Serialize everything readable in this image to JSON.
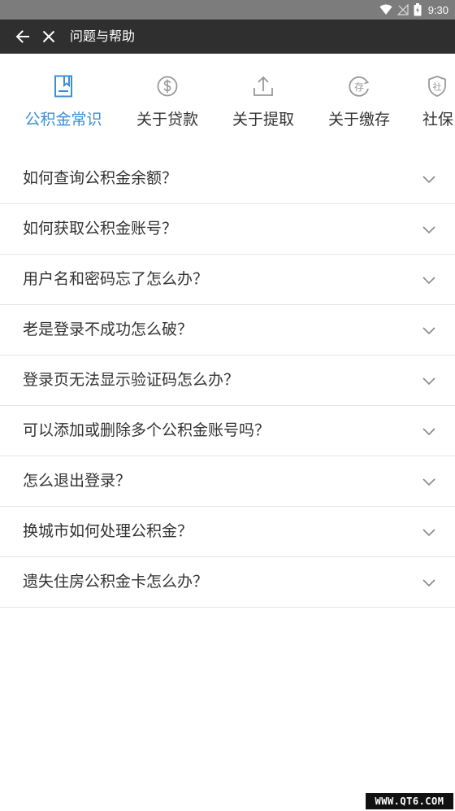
{
  "status_bar": {
    "time": "9:30",
    "icons": [
      "wifi-icon",
      "signal-icon",
      "battery-icon"
    ]
  },
  "app_bar": {
    "title": "问题与帮助",
    "back_icon": "arrow-left-icon",
    "close_icon": "close-icon"
  },
  "tabs": [
    {
      "label": "公积金常识",
      "icon": "document-icon",
      "active": true
    },
    {
      "label": "关于贷款",
      "icon": "dollar-circle-icon",
      "active": false
    },
    {
      "label": "关于提取",
      "icon": "upload-icon",
      "active": false
    },
    {
      "label": "关于缴存",
      "icon": "deposit-icon",
      "active": false
    },
    {
      "label": "社保",
      "icon": "shield-icon",
      "active": false
    }
  ],
  "faq": [
    {
      "question": "如何查询公积金余额？"
    },
    {
      "question": "如何获取公积金账号？"
    },
    {
      "question": "用户名和密码忘了怎么办？"
    },
    {
      "question": "老是登录不成功怎么破？"
    },
    {
      "question": "登录页无法显示验证码怎么办？"
    },
    {
      "question": "可以添加或删除多个公积金账号吗？"
    },
    {
      "question": "怎么退出登录？"
    },
    {
      "question": "换城市如何处理公积金？"
    },
    {
      "question": "遗失住房公积金卡怎么办？"
    }
  ],
  "watermark": "WWW.QT6.COM",
  "colors": {
    "accent": "#3a8fd6",
    "app_bar": "#2f2f2f",
    "status_bar": "#7c7c7c",
    "icon_gray": "#999999"
  }
}
